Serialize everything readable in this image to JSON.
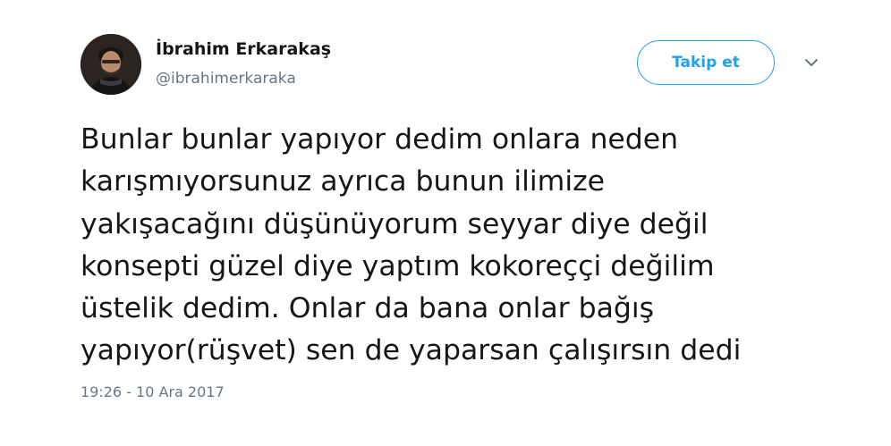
{
  "author": {
    "display_name": "İbrahim Erkarakaş",
    "username": "@ibrahimerkaraka",
    "avatar_icon": "user-photo-avatar"
  },
  "actions": {
    "follow_label": "Takip et",
    "menu_icon": "chevron-down-icon"
  },
  "tweet": {
    "lines": [
      "Bunlar bunlar yapıyor dedim onlara neden",
      "karışmıyorsunuz ayrıca bunun ilimize",
      "yakışacağını düşünüyorum seyyar diye değil",
      "konsepti güzel diye yaptım kokoreççi değilim",
      "üstelik dedim. Onlar da bana onlar bağış",
      "yapıyor(rüşvet) sen de yaparsan çalışırsın dedi"
    ],
    "timestamp": "19:26 - 10 Ara 2017"
  },
  "colors": {
    "accent": "#1da1f2",
    "text": "#14171a",
    "secondary_text": "#657786"
  }
}
